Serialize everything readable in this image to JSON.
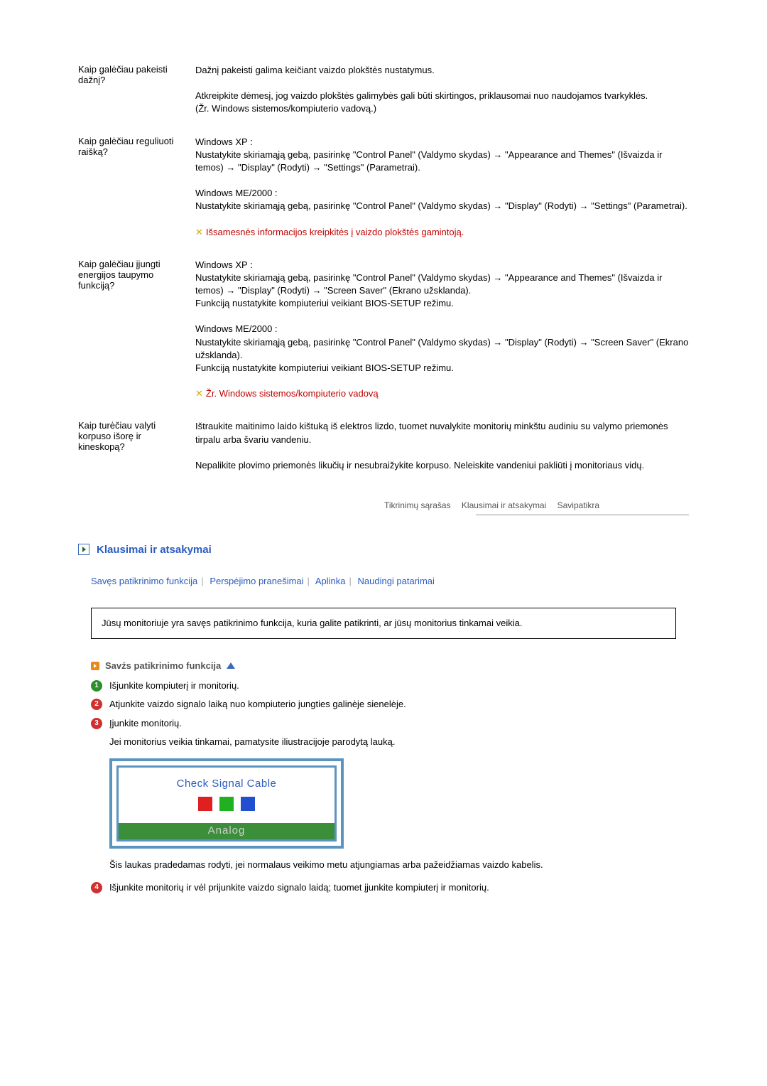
{
  "faqs": [
    {
      "q": "Kaip galėčiau pakeisti dažnį?",
      "a": [
        "Dažnį pakeisti galima keičiant vaizdo plokštės nustatymus.",
        "Atkreipkite dėmesį, jog vaizdo plokštės galimybės gali būti skirtingos, priklausomai nuo naudojamos tvarkyklės.\n(Žr. Windows sistemos/kompiuterio vadovą.)"
      ]
    },
    {
      "q": "Kaip galėčiau reguliuoti raišką?",
      "a": [
        "Windows XP :\nNustatykite skiriamąją gebą, pasirinkę \"Control Panel\" (Valdymo skydas) → \"Appearance and Themes\" (Išvaizda ir temos) → \"Display\" (Rodyti) → \"Settings\" (Parametrai).",
        "Windows ME/2000 :\nNustatykite skiriamąją gebą, pasirinkę \"Control Panel\" (Valdymo skydas) → \"Display\" (Rodyti) → \"Settings\" (Parametrai)."
      ],
      "note": "Išsamesnės informacijos kreipkitės į vaizdo plokštės gamintoją."
    },
    {
      "q": "Kaip galėčiau įjungti energijos taupymo funkciją?",
      "a": [
        "Windows XP :\nNustatykite skiriamąją gebą, pasirinkę \"Control Panel\" (Valdymo skydas) → \"Appearance and Themes\" (Išvaizda ir temos) → \"Display\" (Rodyti) → \"Screen Saver\" (Ekrano užsklanda).\nFunkciją nustatykite kompiuteriui veikiant BIOS-SETUP režimu.",
        "Windows ME/2000 :\nNustatykite skiriamąją gebą, pasirinkę \"Control Panel\" (Valdymo skydas) → \"Display\" (Rodyti) → \"Screen Saver\" (Ekrano užsklanda).\nFunkciją nustatykite kompiuteriui veikiant BIOS-SETUP režimu."
      ],
      "note": "Žr. Windows sistemos/kompiuterio vadovą"
    },
    {
      "q": "Kaip turėčiau valyti korpuso išorę ir kineskopą?",
      "a": [
        "Ištraukite maitinimo laido kištuką iš elektros lizdo, tuomet nuvalykite monitorių minkštu audiniu su valymo priemonės tirpalu arba švariu vandeniu.",
        "Nepalikite plovimo priemonės likučių ir nesubraižykite korpuso. Neleiskite vandeniui pakliūti į monitoriaus vidų."
      ]
    }
  ],
  "tabs": [
    "Tikrinimų sąrašas",
    "Klausimai ir atsakymai",
    "Savipatikra"
  ],
  "section_title": "Klausimai ir atsakymai",
  "sublinks": [
    "Savęs patikrinimo funkcija",
    "Perspėjimo pranešimai",
    "Aplinka",
    "Naudingi patarimai"
  ],
  "notice": "Jūsų monitoriuje yra savęs patikrinimo funkcija, kuria galite patikrinti, ar jūsų monitorius tinkamai veikia.",
  "subsection_title": "Savźs patikrinimo funkcija",
  "steps": [
    "Išjunkite kompiuterį ir monitorių.",
    "Atjunkite vaizdo signalo laiką nuo kompiuterio jungties galinėje sienelėje.",
    "Įjunkite monitorių."
  ],
  "step3_after": "Jei monitorius veikia tinkamai, pamatysite iliustracijoje parodytą lauką.",
  "monitor": {
    "text": "Check Signal Cable",
    "mode": "Analog"
  },
  "after_monitor": "Šis laukas pradedamas rodyti, jei normalaus veikimo metu atjungiamas arba pažeidžiamas vaizdo kabelis.",
  "step4": "Išjunkite monitorių ir vėl prijunkite vaizdo signalo laidą; tuomet įjunkite kompiuterį ir monitorių."
}
